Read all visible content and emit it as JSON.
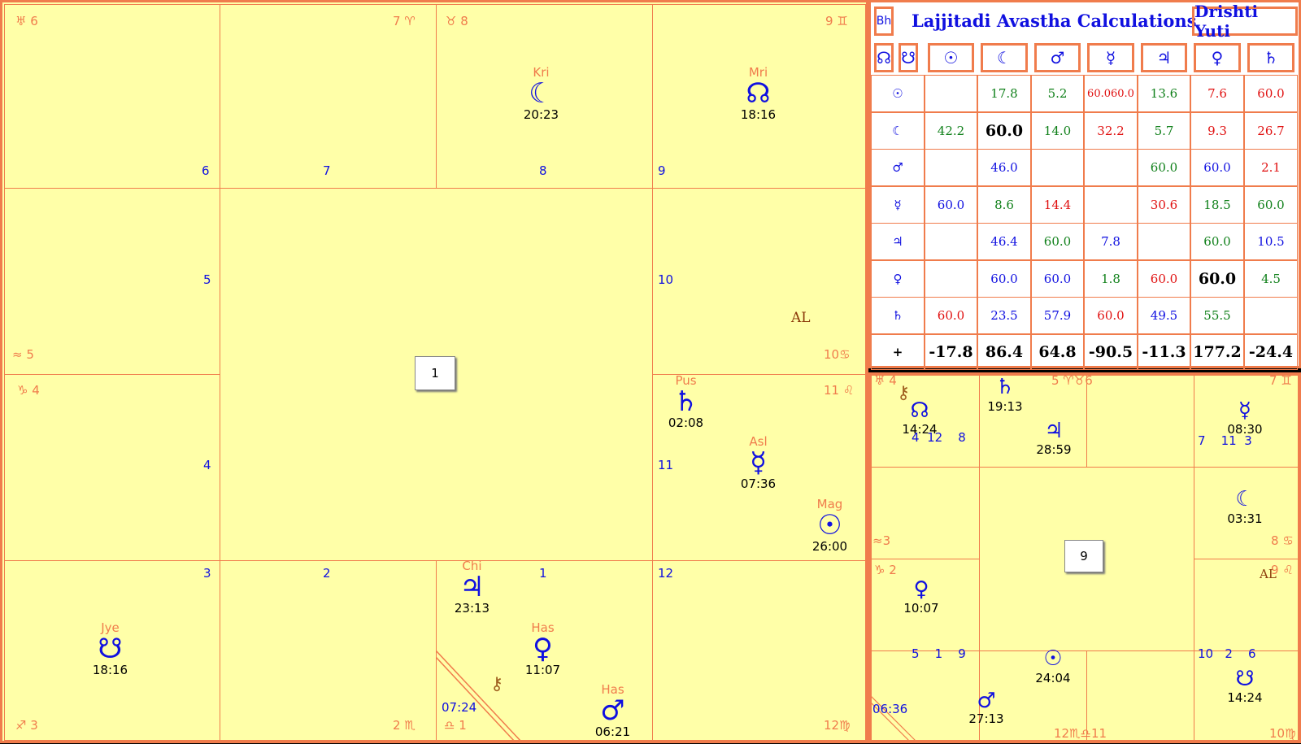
{
  "main_chart": {
    "center_label": "1",
    "houses": [
      {
        "sign_num": "6",
        "sign_sym": "♊",
        "house": "6"
      },
      {
        "sign_num": "7",
        "sign_sym": "♈",
        "house": "7"
      },
      {
        "sign_num": "8",
        "sign_sym": "♉",
        "house": "8"
      },
      {
        "sign_num": "9",
        "sign_sym": "♊",
        "house": "9"
      }
    ],
    "labels": {
      "h5": "5",
      "s5": "5",
      "h4": "4",
      "s4": "4",
      "h3": "3",
      "s3": "3",
      "h2": "2",
      "s2": "2",
      "h1": "1",
      "s1": "1",
      "h12": "12",
      "s12": "12",
      "h10": "10",
      "s10": "10",
      "h11": "11",
      "s11": "11"
    },
    "planets": {
      "moon": {
        "nak": "Kri",
        "glyph": "☾",
        "time": "20:23"
      },
      "rahu": {
        "nak": "Mri",
        "glyph": "☊",
        "time": "18:16"
      },
      "saturn": {
        "nak": "Pus",
        "glyph": "♄",
        "time": "02:08"
      },
      "mercury": {
        "nak": "Asl",
        "glyph": "☿",
        "time": "07:36"
      },
      "sun": {
        "nak": "Mag",
        "glyph": "☉",
        "time": "26:00"
      },
      "jupiter": {
        "nak": "Chi",
        "glyph": "♃",
        "time": "23:13"
      },
      "venus": {
        "nak": "Has",
        "glyph": "♀",
        "time": "11:07"
      },
      "mars": {
        "nak": "Has",
        "glyph": "♂",
        "time": "06:21"
      },
      "ketu": {
        "nak": "Jye",
        "glyph": "☋",
        "time": "18:16"
      },
      "chiron_time": "07:24",
      "al": "AL"
    }
  },
  "table": {
    "left_tab": "Bh",
    "title": "Lajjitadi Avastha Calculations",
    "right_tab": "Drishti Yuti",
    "header": [
      "☊",
      "☋",
      "☉",
      "☾",
      "♂",
      "☿",
      "♃",
      "♀",
      "♄"
    ],
    "rows": [
      {
        "p": "☉",
        "v": [
          "",
          "17.8",
          "5.2",
          "60.060.0",
          "13.6",
          "7.6",
          "60.0"
        ]
      },
      {
        "p": "☾",
        "v": [
          "42.2",
          "60.0",
          "14.0",
          "32.2",
          "5.7",
          "9.3",
          "26.7"
        ]
      },
      {
        "p": "♂",
        "v": [
          "",
          "46.0",
          "",
          "",
          "60.0",
          "60.0",
          "2.1"
        ]
      },
      {
        "p": "☿",
        "v": [
          "60.0",
          "8.6",
          "14.4",
          "",
          "30.6",
          "18.5",
          "60.0"
        ]
      },
      {
        "p": "♃",
        "v": [
          "",
          "46.4",
          "60.0",
          "7.8",
          "",
          "60.0",
          "10.5"
        ]
      },
      {
        "p": "♀",
        "v": [
          "",
          "60.0",
          "60.0",
          "1.8",
          "60.0",
          "60.0",
          "4.5"
        ]
      },
      {
        "p": "♄",
        "v": [
          "60.0",
          "23.5",
          "57.9",
          "60.0",
          "49.5",
          "55.5",
          ""
        ]
      },
      {
        "p": "+",
        "v": [
          "-17.8",
          "86.4",
          "64.8",
          "-90.5",
          "-11.3",
          "177.2",
          "-24.4"
        ]
      }
    ],
    "colors": {
      "green": "#10801a",
      "red": "#e01010",
      "blue": "#1010e0",
      "black": "#000000"
    }
  },
  "navamsa": {
    "center_label": "9",
    "items": {
      "rahu_time": "14:24",
      "hs1": "4",
      "hs2": "12",
      "hs3": "8",
      "sat_time": "19:13",
      "jup_time": "28:59",
      "mer_time": "08:30",
      "mh1": "7",
      "mh2": "11",
      "mh3": "3",
      "moon_time": "03:31",
      "al": "AL",
      "ven_time": "10:07",
      "b1": "5",
      "b2": "1",
      "b3": "9",
      "sun_time": "24:04",
      "mars_time": "27:13",
      "c1": "10",
      "c2": "2",
      "c3": "6",
      "ketu_time": "14:24",
      "bl_time": "06:36"
    },
    "signs": {
      "tl": "4",
      "t2": "5",
      "t3": "6",
      "tr": "7",
      "l1": "3",
      "l2": "2",
      "r1": "8",
      "r2": "9",
      "b12": "12",
      "b11": "11",
      "br": "10"
    }
  }
}
